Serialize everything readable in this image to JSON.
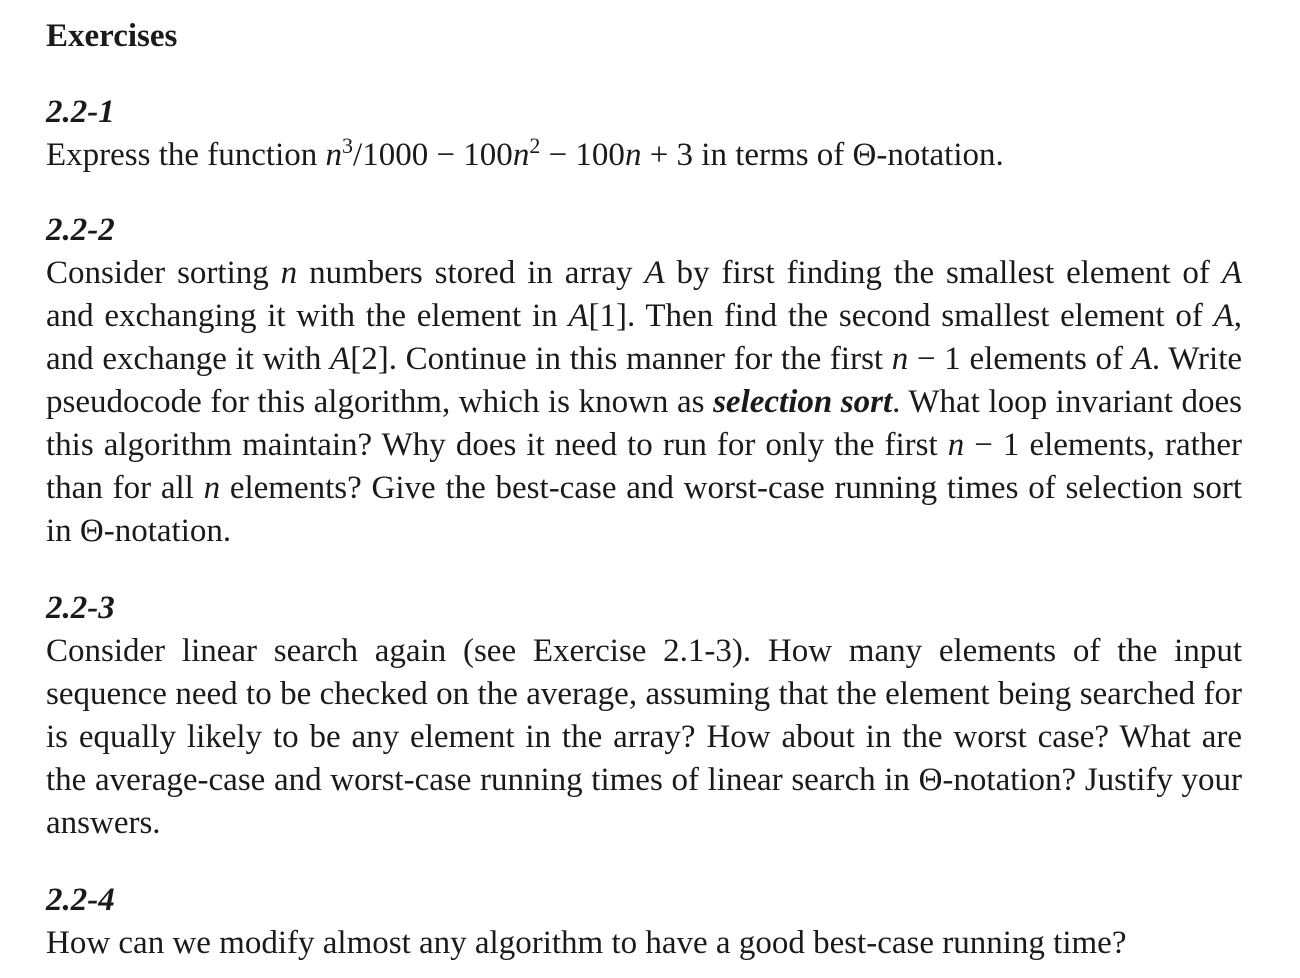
{
  "heading": "Exercises",
  "exercises": [
    {
      "number": "2.2-1",
      "segments": [
        {
          "t": "Express the function ",
          "s": "n"
        },
        {
          "t": "n",
          "s": "m"
        },
        {
          "t": "3",
          "s": "sup"
        },
        {
          "t": "/1000 − 100",
          "s": "n"
        },
        {
          "t": "n",
          "s": "m"
        },
        {
          "t": "2",
          "s": "sup"
        },
        {
          "t": " − 100",
          "s": "n"
        },
        {
          "t": "n",
          "s": "m"
        },
        {
          "t": " + 3 in terms of Θ-notation.",
          "s": "n"
        }
      ]
    },
    {
      "number": "2.2-2",
      "segments": [
        {
          "t": "Consider sorting ",
          "s": "n"
        },
        {
          "t": "n",
          "s": "m"
        },
        {
          "t": " numbers stored in array ",
          "s": "n"
        },
        {
          "t": "A",
          "s": "m"
        },
        {
          "t": " by first finding the smallest element of ",
          "s": "n"
        },
        {
          "t": "A",
          "s": "m"
        },
        {
          "t": " and exchanging it with the element in ",
          "s": "n"
        },
        {
          "t": "A",
          "s": "m"
        },
        {
          "t": "[1]. Then find the second smallest element of ",
          "s": "n"
        },
        {
          "t": "A",
          "s": "m"
        },
        {
          "t": ", and exchange it with ",
          "s": "n"
        },
        {
          "t": "A",
          "s": "m"
        },
        {
          "t": "[2]. Continue in this manner for the first ",
          "s": "n"
        },
        {
          "t": "n",
          "s": "m"
        },
        {
          "t": " − 1 elements of ",
          "s": "n"
        },
        {
          "t": "A",
          "s": "m"
        },
        {
          "t": ". Write pseudocode for this algorithm, which is known as ",
          "s": "n"
        },
        {
          "t": "selection sort",
          "s": "bi"
        },
        {
          "t": ". What loop invariant does this algorithm maintain? Why does it need to run for only the first ",
          "s": "n"
        },
        {
          "t": "n",
          "s": "m"
        },
        {
          "t": " − 1 elements, rather than for all ",
          "s": "n"
        },
        {
          "t": "n",
          "s": "m"
        },
        {
          "t": " elements? Give the best-case and worst-case running times of selection sort in Θ-notation.",
          "s": "n"
        }
      ]
    },
    {
      "number": "2.2-3",
      "segments": [
        {
          "t": "Consider linear search again (see Exercise 2.1-3). How many elements of the in­put sequence need to be checked on the average, assuming that the element being searched for is equally likely to be any element in the array? How about in the worst case? What are the average-case and worst-case running times of linear search in Θ-notation? Justify your answers.",
          "s": "n"
        }
      ]
    },
    {
      "number": "2.2-4",
      "segments": [
        {
          "t": "How can we modify almost any algorithm to have a good best-case running time?",
          "s": "n"
        }
      ]
    }
  ]
}
